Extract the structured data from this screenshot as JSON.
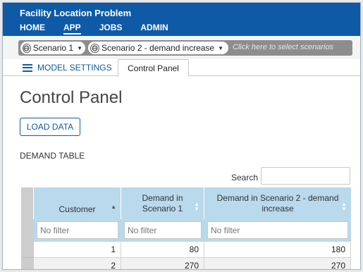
{
  "app": {
    "title": "Facility Location Problem",
    "nav": [
      "HOME",
      "APP",
      "JOBS",
      "ADMIN"
    ],
    "active_nav": "APP",
    "brand_color": "#0e5aa7"
  },
  "scenarios": {
    "chips": [
      "Scenario 1",
      "Scenario 2 - demand increase"
    ],
    "hint": "Click here to select scenarios"
  },
  "tabs": {
    "settings": "MODEL SETTINGS",
    "panel": "Control Panel",
    "active": "Control Panel"
  },
  "page": {
    "title": "Control Panel",
    "load_button": "LOAD DATA",
    "section": "DEMAND TABLE",
    "search_label": "Search"
  },
  "table": {
    "columns": [
      "Customer",
      "Demand in Scenario 1",
      "Demand in Scenario 2 - demand increase"
    ],
    "column_lines": [
      [
        "Customer"
      ],
      [
        "Demand in",
        "Scenario 1"
      ],
      [
        "Demand in Scenario 2 - demand",
        "increase"
      ]
    ],
    "filter_placeholder": "No filter",
    "rows": [
      [
        "1",
        "80",
        "180"
      ],
      [
        "2",
        "270",
        "270"
      ]
    ],
    "header_color": "#b9d9ec"
  }
}
